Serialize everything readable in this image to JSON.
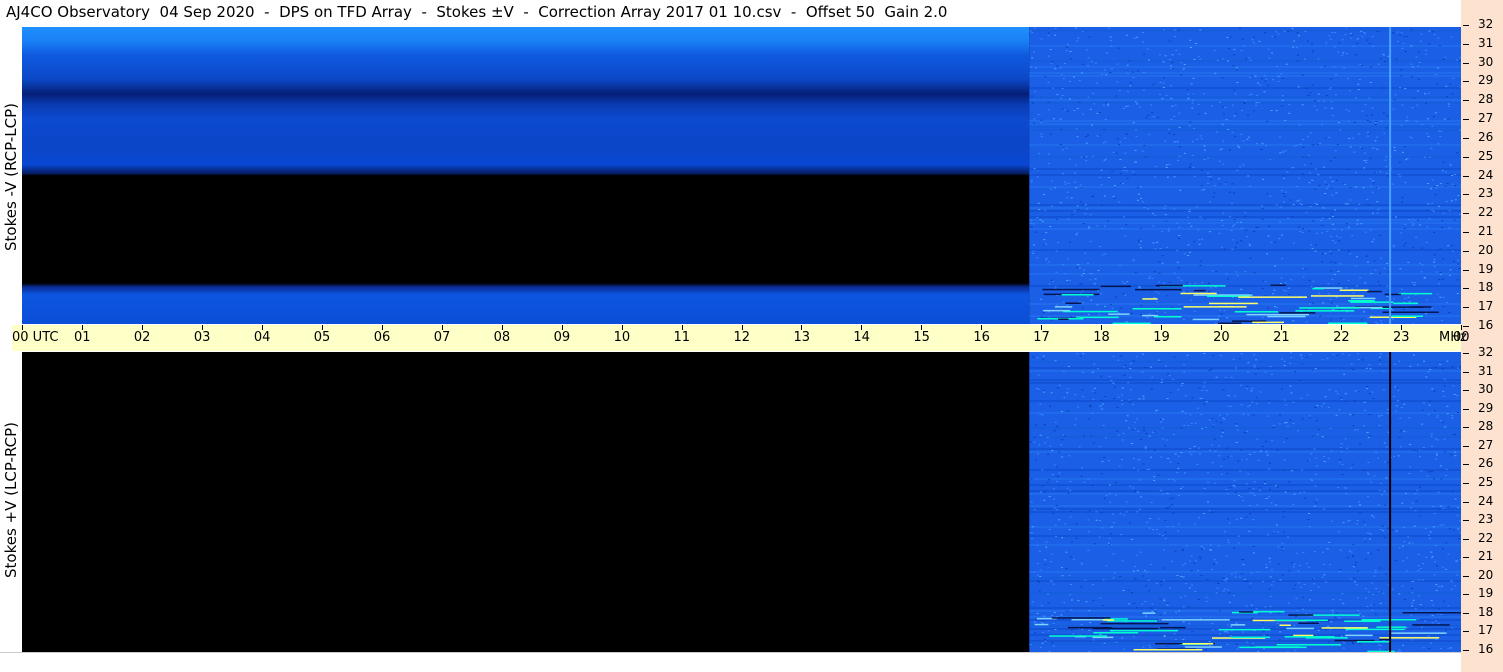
{
  "title": "AJ4CO Observatory  04 Sep 2020  -  DPS on TFD Array  -  Stokes ±V  -  Correction Array 2017 01 10.csv  -  Offset 50  Gain 2.0",
  "colors": {
    "time_axis_bg": "#ffffc8",
    "freq_strip_bg": "#fde3cf",
    "no_signal": "#000000",
    "spectrum_blue": "#1a5fe6",
    "bright_blue": "#1e90ff"
  },
  "chart_data": [
    {
      "type": "heatmap",
      "title": "",
      "ylabel": "Stokes -V (RCP-LCP)",
      "x_ticks": [
        "00 UTC",
        "01",
        "02",
        "03",
        "04",
        "05",
        "06",
        "07",
        "08",
        "09",
        "10",
        "11",
        "12",
        "13",
        "14",
        "15",
        "16",
        "17",
        "18",
        "19",
        "20",
        "21",
        "22",
        "23",
        "00"
      ],
      "xlim_utc_hours": [
        0,
        24
      ],
      "y_ticks_mhz": [
        32,
        31,
        30,
        29,
        28,
        27,
        26,
        25,
        24,
        23,
        22,
        21,
        20,
        19,
        18,
        17,
        16
      ],
      "ylim_mhz": [
        16,
        32
      ],
      "data_start_utc_hours": 16.8,
      "background_bands_mhz": [
        {
          "from": 32,
          "to": 30.5,
          "intensity": "bright"
        },
        {
          "from": 30.5,
          "to": 28.5,
          "intensity": "medium"
        },
        {
          "from": 28.5,
          "to": 27.5,
          "intensity": "dark"
        },
        {
          "from": 27.5,
          "to": 24,
          "intensity": "medium"
        },
        {
          "from": 24,
          "to": 18,
          "intensity": "none"
        },
        {
          "from": 18,
          "to": 16,
          "intensity": "medium"
        }
      ],
      "vertical_lines_utc_hours": [
        22.8
      ]
    },
    {
      "type": "heatmap",
      "title": "",
      "ylabel": "Stokes +V (LCP-RCP)",
      "xlim_utc_hours": [
        0,
        24
      ],
      "y_ticks_mhz": [
        32,
        31,
        30,
        29,
        28,
        27,
        26,
        25,
        24,
        23,
        22,
        21,
        20,
        19,
        18,
        17,
        16
      ],
      "ylim_mhz": [
        16,
        32
      ],
      "data_start_utc_hours": 16.8,
      "vertical_lines_utc_hours": [
        22.8
      ]
    }
  ],
  "x_unit_label": "MHz"
}
